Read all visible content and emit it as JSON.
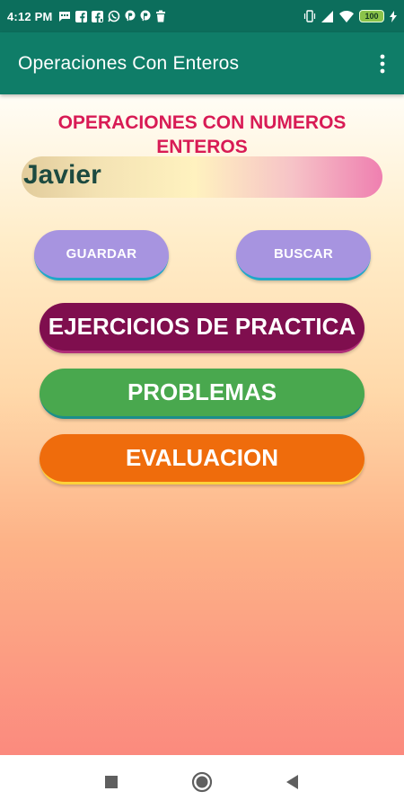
{
  "status_bar": {
    "time": "4:12 PM",
    "battery": "100",
    "left_icons": [
      "message-icon",
      "facebook-icon",
      "facebook-lite-icon",
      "whatsapp-icon",
      "p-app-icon",
      "p-app-icon",
      "trash-icon"
    ],
    "right_icons": [
      "vibrate-icon",
      "signal-icon",
      "wifi-icon",
      "battery-icon",
      "charging-icon"
    ]
  },
  "app_bar": {
    "title": "Operaciones Con Enteros",
    "menu_icon": "more-vert-icon"
  },
  "main": {
    "heading": "OPERACIONES CON NUMEROS ENTEROS",
    "name_input_value": "Javier",
    "guardar_label": "GUARDAR",
    "buscar_label": "BUSCAR",
    "ejercicios_label": "EJERCICIOS DE PRACTICA",
    "problemas_label": "PROBLEMAS",
    "evaluacion_label": "EVALUACION"
  },
  "nav_bar": {
    "icons": [
      "recents-icon",
      "home-icon",
      "back-icon"
    ]
  },
  "colors": {
    "status_bar": "#0c6e5c",
    "app_bar": "#0f7d68",
    "heading": "#d81b55",
    "small_buttons": "#a794e0",
    "ejercicios": "#7f0e4e",
    "problemas": "#49a84e",
    "evaluacion": "#ef6c0c"
  }
}
